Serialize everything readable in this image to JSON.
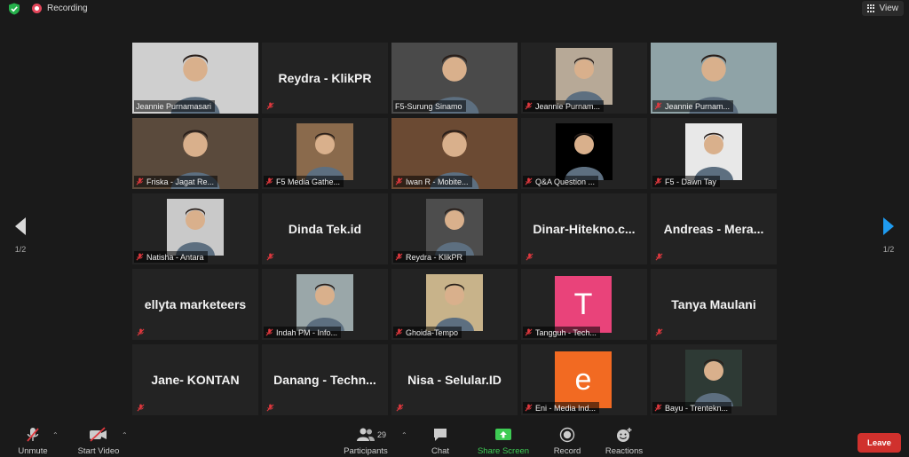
{
  "meeting": {
    "recording_label": "Recording",
    "view_label": "View",
    "page_indicator": "1/2"
  },
  "gallery": {
    "rows": [
      [
        {
          "name": "Jeannie Purnamasari",
          "kind": "video",
          "speaking": true,
          "muted": false,
          "bg": "#cfcfcf"
        },
        {
          "name": "Reydra - KlikPR",
          "kind": "name"
        },
        {
          "name": "F5-Surung Sinamo",
          "kind": "video",
          "muted": false,
          "bg": "#4a4a4a"
        },
        {
          "name": "Jeannie Purnam...",
          "kind": "video",
          "muted": true,
          "bg": "#b7a997"
        },
        {
          "name": "Jeannie Purnam...",
          "kind": "video",
          "muted": true,
          "bg": "#8fa3a7"
        }
      ],
      [
        {
          "name": "Friska - Jagat Re...",
          "kind": "video",
          "muted": true,
          "bg": "#5a4a3c"
        },
        {
          "name": "F5 Media Gathe...",
          "kind": "video",
          "muted": true,
          "bg": "#8a6a4c"
        },
        {
          "name": "Iwan R - Mobite...",
          "kind": "video",
          "muted": true,
          "bg": "#6b4a33"
        },
        {
          "name": "Q&A Question ...",
          "kind": "video",
          "muted": true,
          "bg": "#000000"
        },
        {
          "name": "F5 - Dawn Tay",
          "kind": "video",
          "muted": true,
          "bg": "#e8e8e8"
        }
      ],
      [
        {
          "name": "Natisha - Antara",
          "kind": "video",
          "muted": true,
          "bg": "#c9c9c9"
        },
        {
          "name": "Dinda Tek.id",
          "kind": "name"
        },
        {
          "name": "Reydra - KlikPR",
          "kind": "video",
          "muted": true,
          "bg": "#4d4d4d"
        },
        {
          "name": "Dinar-Hitekno.c...",
          "kind": "name"
        },
        {
          "name": "Andreas  - Mera...",
          "kind": "name"
        }
      ],
      [
        {
          "name": "ellyta marketeers",
          "kind": "name"
        },
        {
          "name": "Indah PM - Info...",
          "kind": "video",
          "muted": true,
          "bg": "#9aa7a9"
        },
        {
          "name": "Ghoida-Tempo",
          "kind": "video",
          "muted": true,
          "bg": "#c8b38a"
        },
        {
          "name": "Tangguh - Tech...",
          "kind": "avatar",
          "letter": "T",
          "color": "#e9437a",
          "muted": true
        },
        {
          "name": "Tanya Maulani",
          "kind": "name"
        }
      ],
      [
        {
          "name": "Jane- KONTAN",
          "kind": "name"
        },
        {
          "name": "Danang  - Techn...",
          "kind": "name"
        },
        {
          "name": "Nisa - Selular.ID",
          "kind": "name"
        },
        {
          "name": "Eni - Media Ind...",
          "kind": "avatar",
          "letter": "e",
          "color": "#f26a22",
          "muted": true
        },
        {
          "name": "Bayu - Trentekn...",
          "kind": "video",
          "muted": true,
          "bg": "#2e3a35"
        }
      ]
    ]
  },
  "toolbar": {
    "unmute_label": "Unmute",
    "start_video_label": "Start Video",
    "participants_label": "Participants",
    "participants_count": "29",
    "chat_label": "Chat",
    "share_screen_label": "Share Screen",
    "record_label": "Record",
    "reactions_label": "Reactions",
    "leave_label": "Leave"
  },
  "colors": {
    "speaking_border": "#c8e64a",
    "share_green": "#3ecb54",
    "leave_red": "#d0312d",
    "mute_red": "#e0383e",
    "nav_blue": "#1f9bf0"
  }
}
